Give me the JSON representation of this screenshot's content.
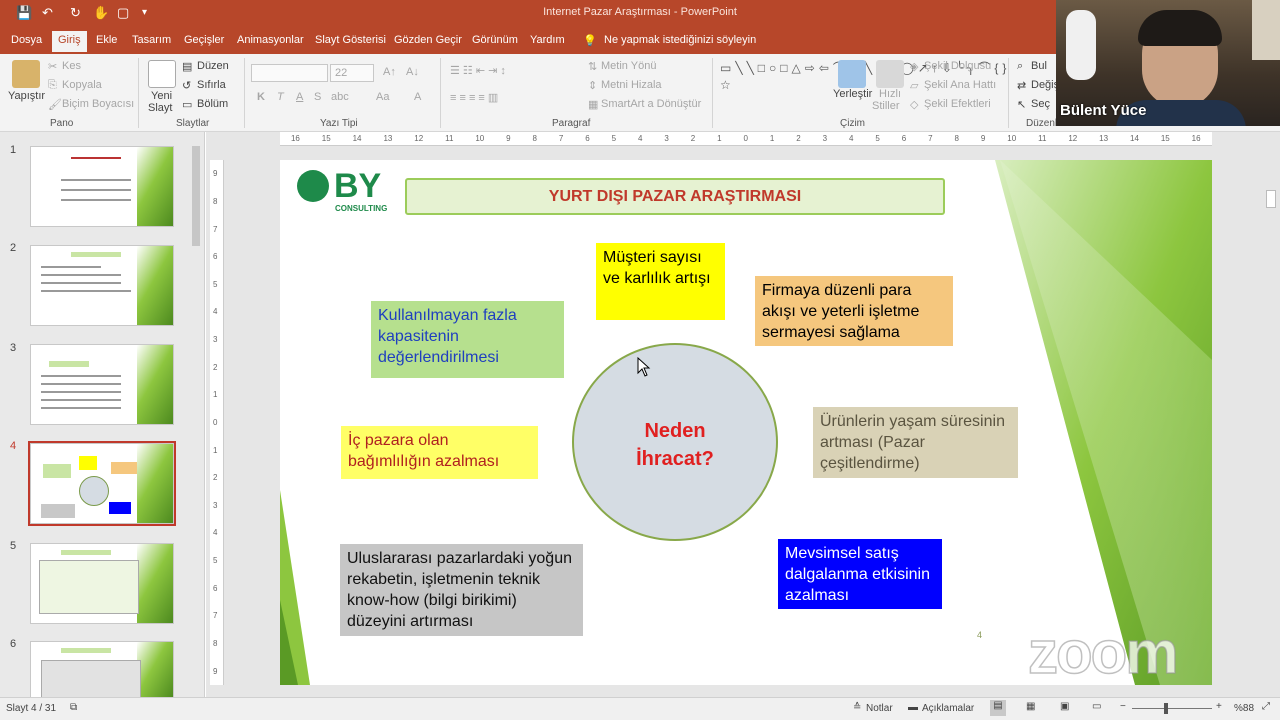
{
  "window": {
    "title": "Internet Pazar Araştırması - PowerPoint"
  },
  "quick_access": {
    "save_icon": "💾",
    "undo_icon": "↶",
    "redo_icon": "↻",
    "touch_icon": "✋",
    "new_icon": "▢",
    "customize_icon": "▾"
  },
  "tabs": [
    "Dosya",
    "Giriş",
    "Ekle",
    "Tasarım",
    "Geçişler",
    "Animasyonlar",
    "Slayt Gösterisi",
    "Gözden Geçir",
    "Görünüm",
    "Yardım"
  ],
  "active_tab": "Giriş",
  "tell_me": "Ne yapmak istediğinizi söyleyin",
  "ribbon": {
    "pano": {
      "paste": "Yapıştır",
      "cut": "Kes",
      "copy": "Kopyala",
      "format_painter": "Biçim Boyacısı",
      "label": "Pano"
    },
    "slaytlar": {
      "new_slide_1": "Yeni",
      "new_slide_2": "Slayt",
      "layout": "Düzen",
      "reset": "Sıfırla",
      "section": "Bölüm",
      "label": "Slaytlar"
    },
    "yazi_tipi": {
      "font_size": "22",
      "bold": "K",
      "italic": "T",
      "underline": "A",
      "strike": "S",
      "spacing": "abc",
      "case": "Aa",
      "color": "A",
      "label": "Yazı Tipi"
    },
    "paragraf": {
      "text_direction": "Metin Yönü",
      "align_text": "Metni Hizala",
      "smartart": "SmartArt a Dönüştür",
      "label": "Paragraf"
    },
    "cizim": {
      "arrange_1": "Yerleştir",
      "quick_styles_1": "Hızlı",
      "quick_styles_2": "Stiller",
      "fill": "Şekil Dolgusu",
      "outline": "Şekil Ana Hattı",
      "effects": "Şekil Efektleri",
      "label": "Çizim"
    },
    "duzenleme": {
      "find": "Bul",
      "replace": "Değiş",
      "select": "Seç",
      "label": "Düzenle"
    }
  },
  "ruler_h": [
    "16",
    "15",
    "14",
    "13",
    "12",
    "11",
    "10",
    "9",
    "8",
    "7",
    "6",
    "5",
    "4",
    "3",
    "2",
    "1",
    "0",
    "1",
    "2",
    "3",
    "4",
    "5",
    "6",
    "7",
    "8",
    "9",
    "10",
    "11",
    "12",
    "13",
    "14",
    "15",
    "16"
  ],
  "ruler_v": [
    "9",
    "8",
    "7",
    "6",
    "5",
    "4",
    "3",
    "2",
    "1",
    "0",
    "1",
    "2",
    "3",
    "4",
    "5",
    "6",
    "7",
    "8",
    "9"
  ],
  "thumbnails": [
    {
      "num": "1"
    },
    {
      "num": "2"
    },
    {
      "num": "3"
    },
    {
      "num": "4"
    },
    {
      "num": "5"
    },
    {
      "num": "6"
    }
  ],
  "slide": {
    "logo_text": "BY",
    "logo_sub": "CONSULTING",
    "title": "YURT DIŞI PAZAR ARAŞTIRMASI",
    "center_line1": "Neden",
    "center_line2": "İhracat?",
    "page_num": "4",
    "boxes": {
      "musteri": "Müşteri sayısı ve karlılık artışı",
      "firmaya": "Firmaya düzenli para akışı ve yeterli işletme sermayesi sağlama",
      "kullanilmayan": "Kullanılmayan fazla kapasitenin değerlendirilmesi",
      "ic_pazar": "İç pazara olan bağımlılığın azalması",
      "urunlerin": "Ürünlerin yaşam süresinin artması (Pazar çeşitlendirme)",
      "uluslararasi": "Uluslararası pazarlardaki yoğun rekabetin, işletmenin teknik know-how (bilgi birikimi) düzeyini artırması",
      "mevsimsel": "Mevsimsel satış dalgalanma etkisinin azalması"
    }
  },
  "status": {
    "slide_info": "Slayt 4 / 31",
    "notes": "Notlar",
    "comments": "Açıklamalar",
    "zoom": "%88"
  },
  "webcam": {
    "name": "Bülent Yüce"
  },
  "zoom_watermark": "zoom",
  "colors": {
    "accent": "#b7472a",
    "green": "#8dc63f",
    "title_red": "#c0392b"
  }
}
